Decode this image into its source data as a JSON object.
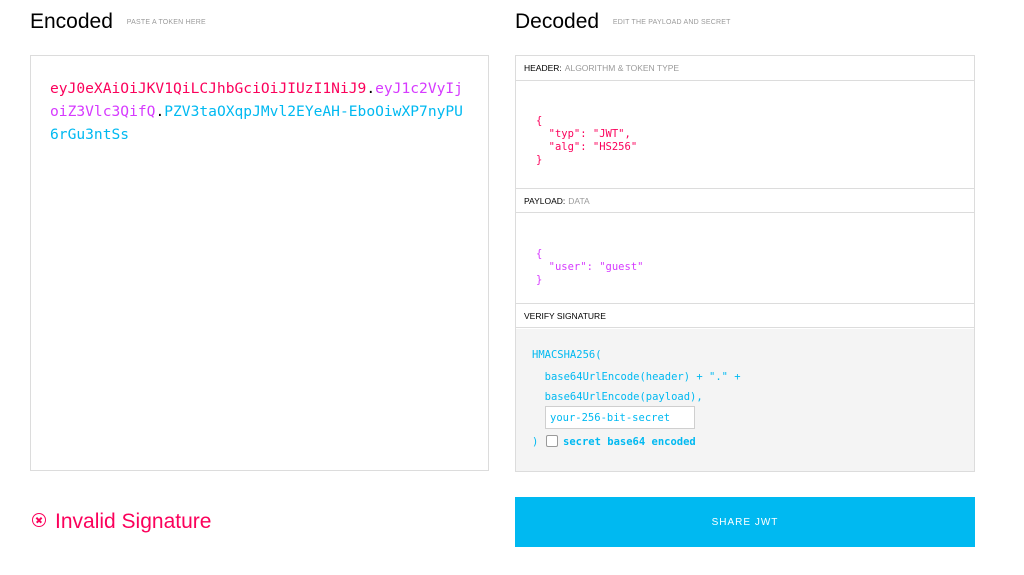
{
  "encoded": {
    "title": "Encoded",
    "subtitle": "PASTE A TOKEN HERE",
    "token_header": "eyJ0eXAiOiJKV1QiLCJhbGciOiJIUzI1NiJ9",
    "token_payload": "eyJ1c2VyIjoiZ3Vlc3QifQ",
    "token_signature": "PZV3taOXqpJMvl2EYeAH-EboOiwXP7nyPU6rGu3ntSs",
    "dot": "."
  },
  "decoded": {
    "title": "Decoded",
    "subtitle": "EDIT THE PAYLOAD AND SECRET",
    "header": {
      "label": "HEADER:",
      "label_light": "ALGORITHM & TOKEN TYPE",
      "lines": [
        "{",
        "  \"typ\": \"JWT\",",
        "  \"alg\": \"HS256\"",
        "}"
      ]
    },
    "payload": {
      "label": "PAYLOAD:",
      "label_light": "DATA",
      "lines": [
        "{",
        "  \"user\": \"guest\"",
        "}"
      ]
    },
    "verify": {
      "label": "VERIFY SIGNATURE",
      "line1": "HMACSHA256(",
      "line2": "  base64UrlEncode(header) + \".\" +",
      "line3": "  base64UrlEncode(payload),",
      "secret_value": "your-256-bit-secret",
      "close_paren": ")",
      "checkbox_label": "secret base64 encoded"
    }
  },
  "status": {
    "text": "Invalid Signature",
    "icon": "x-circle-icon",
    "color": "#fb015b"
  },
  "share_button": {
    "label": "SHARE JWT",
    "color": "#00b9f1"
  }
}
